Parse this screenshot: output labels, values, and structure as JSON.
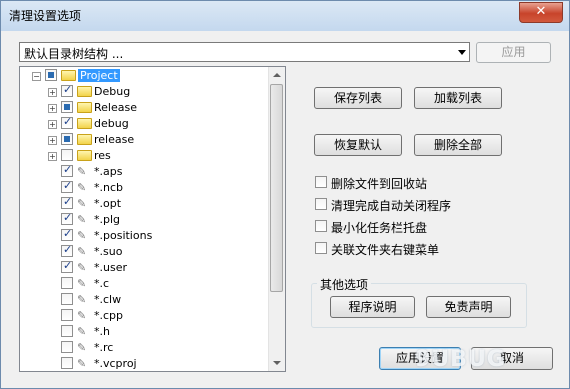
{
  "window": {
    "title": "清理设置选项",
    "close_symbol": "✕"
  },
  "preset_combo": {
    "value": "默认目录树结构 ..."
  },
  "apply_button": "应用",
  "tree": {
    "items": [
      {
        "label": "Project",
        "kind": "folder",
        "expander": "−",
        "state": "partial",
        "selected": true
      },
      {
        "label": "Debug",
        "kind": "folder",
        "expander": "+",
        "state": "checked"
      },
      {
        "label": "Release",
        "kind": "folder",
        "expander": "+",
        "state": "partial"
      },
      {
        "label": "debug",
        "kind": "folder",
        "expander": "+",
        "state": "checked"
      },
      {
        "label": "release",
        "kind": "folder",
        "expander": "+",
        "state": "partial"
      },
      {
        "label": "res",
        "kind": "folder",
        "expander": "+",
        "state": "unchecked"
      },
      {
        "label": "*.aps",
        "kind": "file",
        "state": "checked"
      },
      {
        "label": "*.ncb",
        "kind": "file",
        "state": "checked"
      },
      {
        "label": "*.opt",
        "kind": "file",
        "state": "checked"
      },
      {
        "label": "*.plg",
        "kind": "file",
        "state": "checked"
      },
      {
        "label": "*.positions",
        "kind": "file",
        "state": "checked"
      },
      {
        "label": "*.suo",
        "kind": "file",
        "state": "checked"
      },
      {
        "label": "*.user",
        "kind": "file",
        "state": "checked"
      },
      {
        "label": "*.c",
        "kind": "file",
        "state": "unchecked"
      },
      {
        "label": "*.clw",
        "kind": "file",
        "state": "unchecked"
      },
      {
        "label": "*.cpp",
        "kind": "file",
        "state": "unchecked"
      },
      {
        "label": "*.h",
        "kind": "file",
        "state": "unchecked"
      },
      {
        "label": "*.rc",
        "kind": "file",
        "state": "unchecked"
      },
      {
        "label": "*.vcproj",
        "kind": "file",
        "state": "unchecked"
      }
    ]
  },
  "buttons": {
    "save_list": "保存列表",
    "load_list": "加载列表",
    "restore_default": "恢复默认",
    "delete_all": "删除全部",
    "app_settings": "应用设置",
    "cancel": "取消"
  },
  "options": [
    {
      "label": "删除文件到回收站",
      "checked": false
    },
    {
      "label": "清理完成自动关闭程序",
      "checked": false
    },
    {
      "label": "最小化任务栏托盘",
      "checked": false
    },
    {
      "label": "关联文件夹右键菜单",
      "checked": false
    }
  ],
  "other_options": {
    "title": "其他选项",
    "program_info": "程序说明",
    "disclaimer": "免责声明"
  },
  "watermark": "9UBUG"
}
